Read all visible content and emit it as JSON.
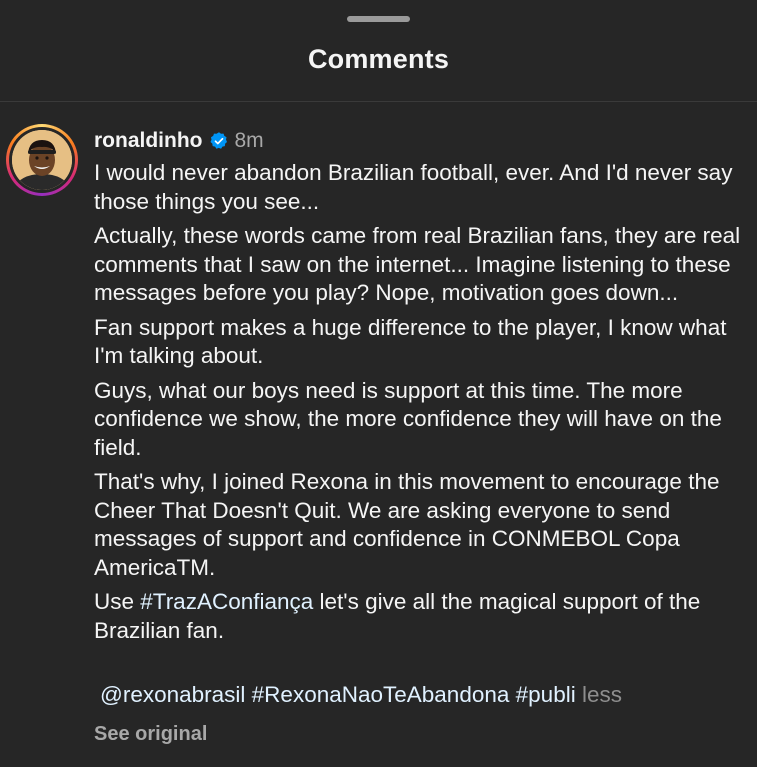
{
  "sheet": {
    "title": "Comments"
  },
  "comment": {
    "username": "ronaldinho",
    "verified": true,
    "time": "8m",
    "paragraphs": [
      "I would never abandon Brazilian football, ever. And I'd never say those things you see...",
      "Actually, these words came from real Brazilian fans, they are real comments that I saw on the internet... Imagine listening to these messages before you play? Nope, motivation goes down...",
      "Fan support makes a huge difference to the player, I know what I'm talking about.",
      "Guys, what our boys need is support at this time. The more confidence we show, the more confidence they will have on the field.",
      "That's why, I joined Rexona in this movement to encourage the Cheer That Doesn't Quit. We are asking everyone to send messages of support and confidence in CONMEBOL Copa AmericaTM."
    ],
    "last_paragraph": {
      "prefix": "Use ",
      "hashtag": "#TrazAConfiança",
      "suffix": " let's give all the magical support of the Brazilian fan."
    },
    "tags": {
      "mention": "@rexonabrasil",
      "hashtag1": "#RexonaNaoTeAbandona",
      "hashtag2": "#publi",
      "less_label": "less"
    },
    "see_original_label": "See original"
  },
  "icons": {
    "verified": "verified-badge-icon",
    "avatar": "profile-avatar"
  },
  "colors": {
    "background": "#262626",
    "text": "#f5f5f5",
    "muted": "#a8a8a8",
    "verified_blue": "#0095f6"
  }
}
